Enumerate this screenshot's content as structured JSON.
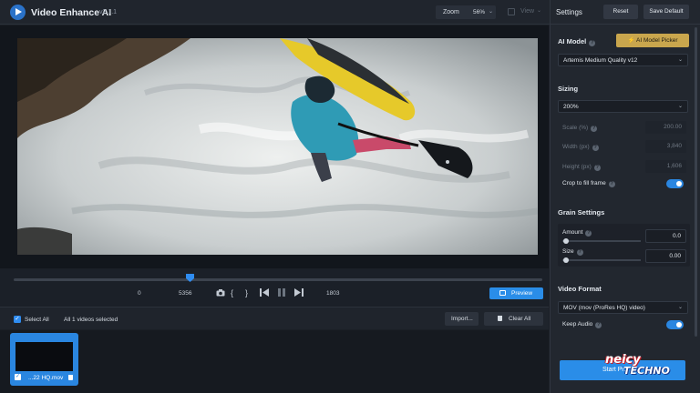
{
  "app": {
    "title": "Video Enhance AI",
    "version": "v2.1.1"
  },
  "toolbar": {
    "zoom_label": "Zoom",
    "zoom_value": "56%",
    "view_label": "View"
  },
  "timeline": {
    "start_tc": "0",
    "current_tc": "5356",
    "end_tc": "1803",
    "preview_label": "Preview",
    "playhead_position": 0.34
  },
  "selection": {
    "select_all_label": "Select All",
    "count_text": "All 1 videos selected",
    "import_label": "Import...",
    "clear_all_label": "Clear All"
  },
  "thumbnail": {
    "filename": "...22 HQ.mov"
  },
  "settings": {
    "title": "Settings",
    "reset_label": "Reset",
    "save_default_label": "Save Default",
    "ai_model": {
      "title": "AI Model",
      "picker_label": "AI Model Picker",
      "selected": "Artemis Medium Quality v12"
    },
    "sizing": {
      "title": "Sizing",
      "preset": "200%",
      "scale_label": "Scale (%)",
      "scale_value": "200.00",
      "width_label": "Width (px)",
      "width_value": "3,840",
      "height_label": "Height (px)",
      "height_value": "1,606",
      "crop_label": "Crop to fill frame",
      "crop_on": true
    },
    "grain": {
      "title": "Grain Settings",
      "amount_label": "Amount",
      "amount_value": "0.0",
      "size_label": "Size",
      "size_value": "0.00"
    },
    "video_format": {
      "title": "Video Format",
      "format": "MOV (mov (ProRes HQ) video)",
      "keep_audio_label": "Keep Audio",
      "keep_audio_on": true
    },
    "start_label": "Start Pr..."
  },
  "watermark": {
    "line1": "neicy",
    "line2": "TECHNO"
  },
  "colors": {
    "accent": "#2a8de8",
    "gold": "#c9a64d",
    "panel": "#22272f",
    "background": "#1b1f26"
  }
}
